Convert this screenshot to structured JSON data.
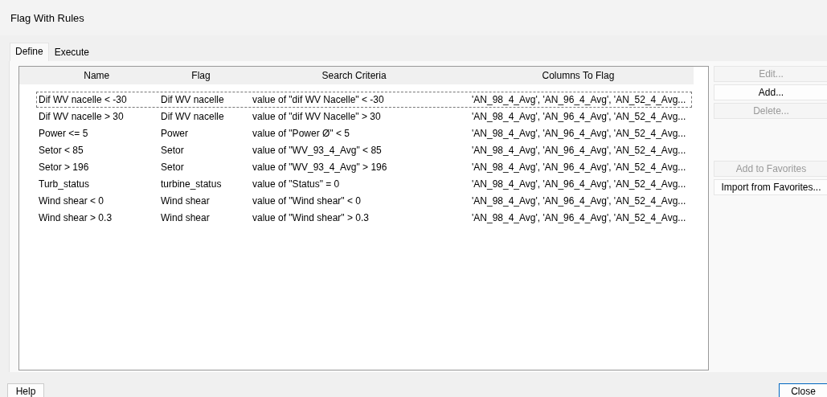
{
  "window": {
    "title": "Flag With Rules"
  },
  "tabs": [
    {
      "label": "Define",
      "selected": true
    },
    {
      "label": "Execute",
      "selected": false
    }
  ],
  "table": {
    "columns": [
      "Name",
      "Flag",
      "Search Criteria",
      "Columns To Flag"
    ],
    "rows": [
      {
        "cells": [
          "Dif WV nacelle < -30",
          "Dif WV nacelle",
          "value of \"dif WV Nacelle\" < -30",
          "'AN_98_4_Avg', 'AN_96_4_Avg', 'AN_52_4_Avg..."
        ],
        "selected": true
      },
      {
        "cells": [
          "Dif WV nacelle > 30",
          "Dif WV nacelle",
          "value of \"dif WV Nacelle\" > 30",
          "'AN_98_4_Avg', 'AN_96_4_Avg', 'AN_52_4_Avg..."
        ],
        "selected": false
      },
      {
        "cells": [
          "Power <= 5",
          "Power",
          "value of \"Power Ø\" < 5",
          "'AN_98_4_Avg', 'AN_96_4_Avg', 'AN_52_4_Avg..."
        ],
        "selected": false
      },
      {
        "cells": [
          "Setor < 85",
          "Setor",
          "value of \"WV_93_4_Avg\" < 85",
          "'AN_98_4_Avg', 'AN_96_4_Avg', 'AN_52_4_Avg..."
        ],
        "selected": false
      },
      {
        "cells": [
          "Setor > 196",
          "Setor",
          "value of \"WV_93_4_Avg\" > 196",
          "'AN_98_4_Avg', 'AN_96_4_Avg', 'AN_52_4_Avg..."
        ],
        "selected": false
      },
      {
        "cells": [
          "Turb_status",
          "turbine_status",
          "value of \"Status\" = 0",
          "'AN_98_4_Avg', 'AN_96_4_Avg', 'AN_52_4_Avg..."
        ],
        "selected": false
      },
      {
        "cells": [
          "Wind shear < 0",
          "Wind shear",
          "value of \"Wind shear\" < 0",
          "'AN_98_4_Avg', 'AN_96_4_Avg', 'AN_52_4_Avg..."
        ],
        "selected": false
      },
      {
        "cells": [
          "Wind shear > 0.3",
          "Wind shear",
          "value of \"Wind shear\" > 0.3",
          "'AN_98_4_Avg', 'AN_96_4_Avg', 'AN_52_4_Avg..."
        ],
        "selected": false
      }
    ]
  },
  "side_buttons": [
    {
      "label": "Edit...",
      "disabled": true
    },
    {
      "label": "Add...",
      "disabled": false
    },
    {
      "label": "Delete...",
      "disabled": true
    }
  ],
  "favorite_buttons": [
    {
      "label": "Add to Favorites",
      "disabled": true
    },
    {
      "label": "Import from Favorites...",
      "disabled": false
    }
  ],
  "footer_buttons": [
    "Help",
    "Close"
  ]
}
